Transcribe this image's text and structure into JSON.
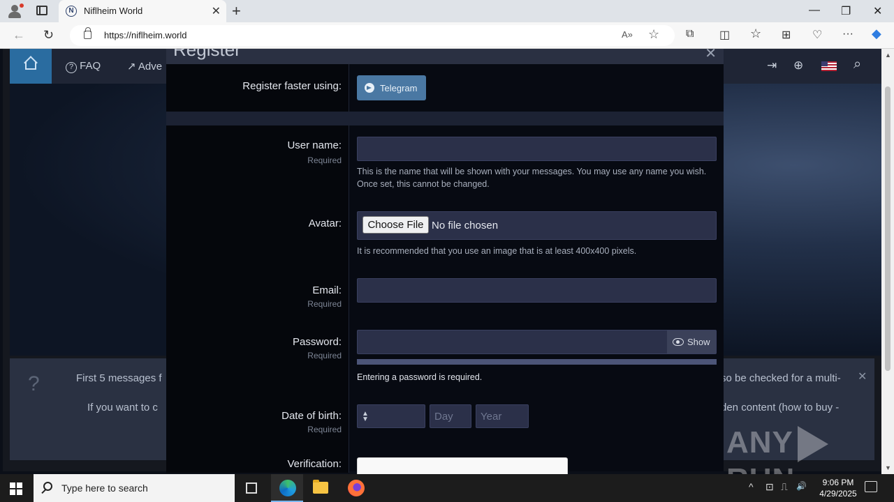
{
  "browser": {
    "tab_title": "Niflheim World",
    "tab_favicon": "N",
    "url": "https://niflheim.world",
    "icons": {
      "back": "←",
      "refresh": "↻",
      "read_aloud": "A»",
      "favorite": "☆",
      "extensions": "⧉",
      "split": "◫",
      "favorites_bar": "☆",
      "collections": "⊞",
      "performance": "♡",
      "more": "···",
      "copilot": "◆",
      "minimize": "—",
      "restore": "❐",
      "close": "✕",
      "newtab": "+",
      "tab_close": "✕"
    }
  },
  "site": {
    "nav": {
      "faq_label": "FAQ",
      "faq_icon": "?",
      "adv_label": "Adve",
      "adv_icon": "↗",
      "login_icon": "⇥",
      "register_icon": "⊕",
      "search_icon": "⌕"
    },
    "notice": {
      "icon": "?",
      "line1_left": "First 5 messages f",
      "line2_left": "If you want to c",
      "line1_right": "so be checked for a multi-",
      "line2_right": "den content (how to buy -",
      "close": "✕"
    },
    "watermark": {
      "left": "ANY",
      "right": "RUN"
    }
  },
  "modal": {
    "title": "Register",
    "close": "✕",
    "register_faster_label": "Register faster using:",
    "telegram_label": "Telegram",
    "username": {
      "label": "User name:",
      "required": "Required",
      "value": "",
      "help": "This is the name that will be shown with your messages. You may use any name you wish. Once set, this cannot be changed."
    },
    "avatar": {
      "label": "Avatar:",
      "button": "Choose File",
      "status": "No file chosen",
      "help": "It is recommended that you use an image that is at least 400x400 pixels."
    },
    "email": {
      "label": "Email:",
      "required": "Required",
      "value": ""
    },
    "password": {
      "label": "Password:",
      "required": "Required",
      "show_label": "Show",
      "help": "Entering a password is required."
    },
    "dob": {
      "label": "Date of birth:",
      "required": "Required",
      "month_value": "",
      "day_placeholder": "Day",
      "year_placeholder": "Year"
    },
    "verification": {
      "label": "Verification:"
    }
  },
  "taskbar": {
    "search_placeholder": "Type here to search",
    "time": "9:06 PM",
    "date": "4/29/2025",
    "tray_icons": [
      "^",
      "⊡",
      "⎍",
      "🔊"
    ]
  }
}
